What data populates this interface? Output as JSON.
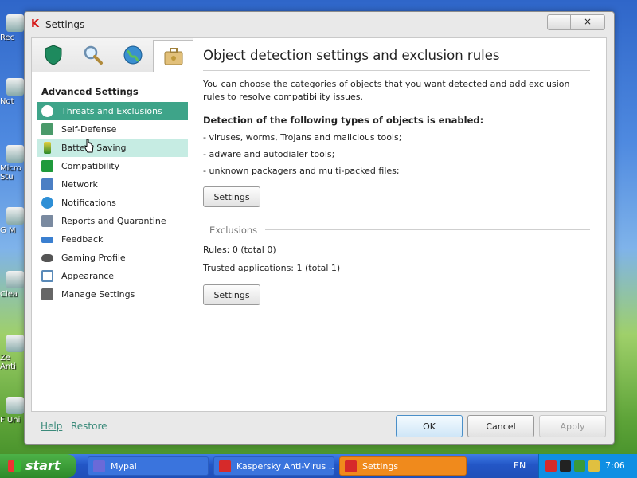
{
  "desktop": {
    "icons": [
      "Rec",
      "Not",
      "Micro Stu",
      "G M",
      "Clea",
      "Ze Anti",
      "F Uni"
    ]
  },
  "window": {
    "title": "Settings",
    "minimize": "–",
    "close": "×"
  },
  "left_panel": {
    "tabs": [
      "shield-tab",
      "search-tab",
      "globe-tab",
      "tools-tab"
    ],
    "heading": "Advanced Settings",
    "items": [
      {
        "label": "Threats and Exclusions",
        "icon": "shield-check-icon",
        "color": "#2a8c5a"
      },
      {
        "label": "Self-Defense",
        "icon": "self-defense-icon",
        "color": "#4a9a6a"
      },
      {
        "label": "Battery Saving",
        "icon": "battery-icon",
        "color": "#d6b21a"
      },
      {
        "label": "Compatibility",
        "icon": "compatibility-icon",
        "color": "#1f9a3c"
      },
      {
        "label": "Network",
        "icon": "network-icon",
        "color": "#4b7fc4"
      },
      {
        "label": "Notifications",
        "icon": "info-icon",
        "color": "#2e8fd6"
      },
      {
        "label": "Reports and Quarantine",
        "icon": "reports-icon",
        "color": "#7a8aa0"
      },
      {
        "label": "Feedback",
        "icon": "feedback-icon",
        "color": "#3a7fd0"
      },
      {
        "label": "Gaming Profile",
        "icon": "gamepad-icon",
        "color": "#555555"
      },
      {
        "label": "Appearance",
        "icon": "appearance-icon",
        "color": "#5a8ab8"
      },
      {
        "label": "Manage Settings",
        "icon": "manage-settings-icon",
        "color": "#666666"
      }
    ]
  },
  "main": {
    "title": "Object detection settings and exclusion rules",
    "intro": "You can choose the categories of objects that you want detected and add exclusion rules to resolve compatibility issues.",
    "detection_heading": "Detection of the following types of objects is enabled:",
    "detection_items": [
      "- viruses, worms, Trojans and malicious tools;",
      "- adware and autodialer tools;",
      "- unknown packagers and multi-packed files;"
    ],
    "settings_button_1": "Settings",
    "exclusions_label": "Exclusions",
    "rules": "Rules: 0 (total 0)",
    "trusted_apps": "Trusted applications: 1 (total 1)",
    "settings_button_2": "Settings"
  },
  "footer": {
    "help": "Help",
    "restore": "Restore",
    "ok": "OK",
    "cancel": "Cancel",
    "apply": "Apply"
  },
  "taskbar": {
    "start": "start",
    "tasks": [
      {
        "label": "Mypal",
        "icon": "mypal-icon"
      },
      {
        "label": "Kaspersky Anti-Virus ...",
        "icon": "kaspersky-icon"
      },
      {
        "label": "Settings",
        "icon": "kaspersky-icon"
      }
    ],
    "language": "EN",
    "clock": "7:06"
  },
  "colors": {
    "accent": "#3ea489",
    "hover": "#c6ece3",
    "link": "#3a8a7a"
  }
}
